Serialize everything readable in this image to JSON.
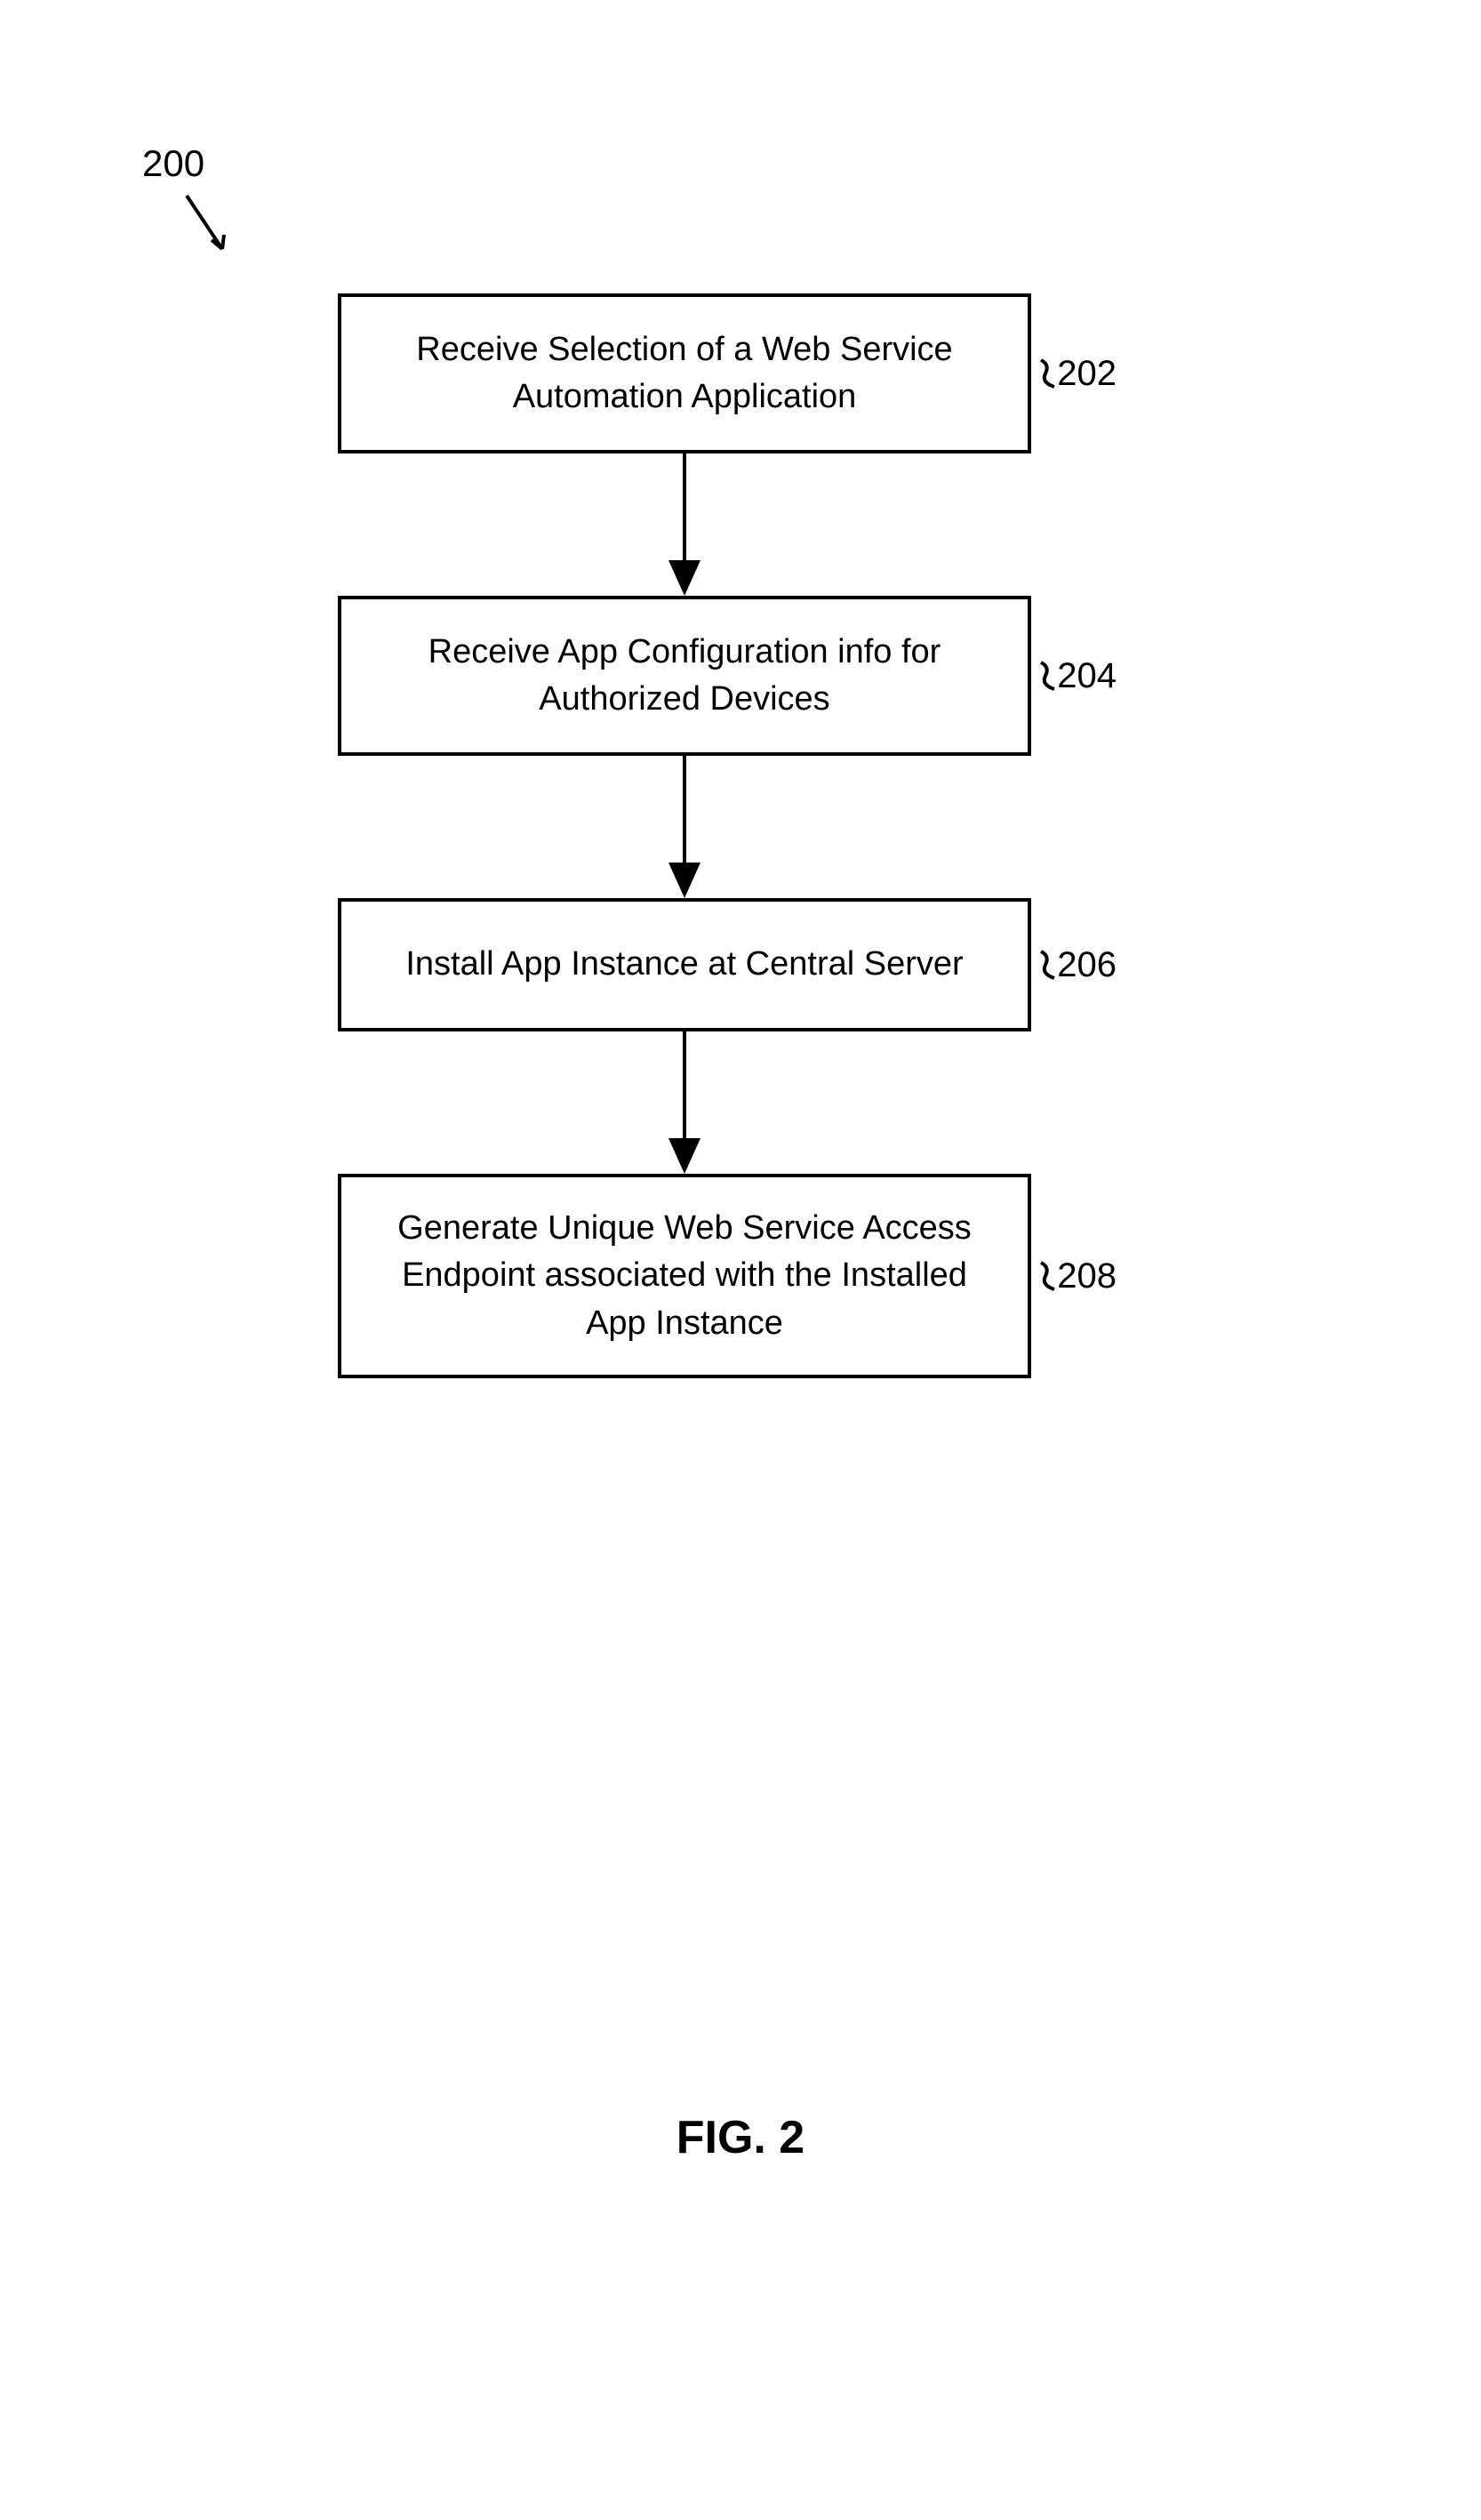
{
  "figure_number": "200",
  "caption": "FIG. 2",
  "steps": [
    {
      "ref": "202",
      "text": "Receive Selection of a Web Service Automation Application"
    },
    {
      "ref": "204",
      "text": "Receive App Configuration info for Authorized Devices"
    },
    {
      "ref": "206",
      "text": "Install App Instance at Central Server"
    },
    {
      "ref": "208",
      "text": "Generate Unique Web Service Access Endpoint associated with the Installed App Instance"
    }
  ]
}
